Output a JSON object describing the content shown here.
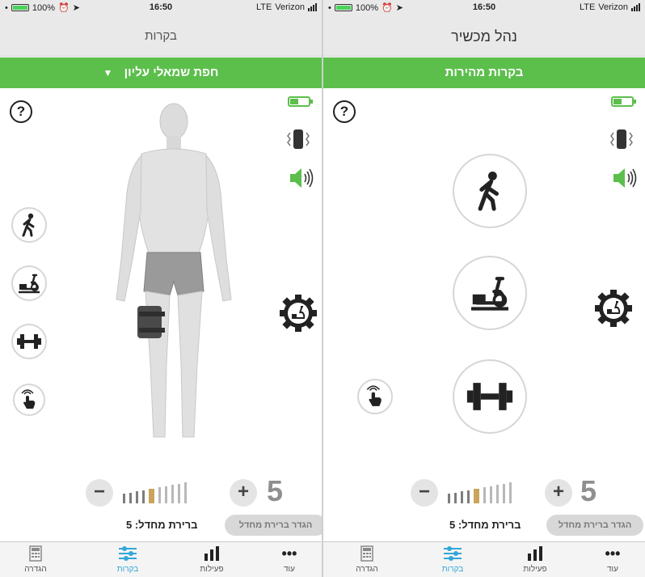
{
  "status_left": {
    "battery_pct": "100%",
    "time": "16:50",
    "network": "LTE",
    "carrier": "Verizon"
  },
  "status_right": {
    "battery_pct": "100%",
    "time": "16:50",
    "network": "LTE",
    "carrier": "Verizon"
  },
  "left": {
    "nav_title": "בקרות",
    "location_selector": "חפת שמאלי עליון",
    "help": "?",
    "intensity": {
      "minus": "−",
      "plus": "+",
      "value": "5",
      "level": 5,
      "max": 10
    },
    "default_label": "ברירת מחדל: 5",
    "set_default_button": "הגדר ברירת מחדל"
  },
  "right": {
    "nav_title": "נהל מכשיר",
    "green_header": "בקרות מהירות",
    "help": "?",
    "intensity": {
      "minus": "−",
      "plus": "+",
      "value": "5",
      "level": 5,
      "max": 10
    },
    "default_label": "ברירת מחדל: 5",
    "set_default_button": "הגדר ברירת מחדל"
  },
  "tabs": [
    {
      "label": "הגדרה",
      "icon": "calculator-icon",
      "active": false
    },
    {
      "label": "בקרות",
      "icon": "sliders-icon",
      "active": true
    },
    {
      "label": "פעילות",
      "icon": "bar-chart-icon",
      "active": false
    },
    {
      "label": "עוד",
      "icon": "more-icon",
      "active": false
    }
  ],
  "colors": {
    "accent_green": "#5cbf4c",
    "active_tab": "#33a7d8",
    "intensity_marker": "#c9a45a"
  }
}
